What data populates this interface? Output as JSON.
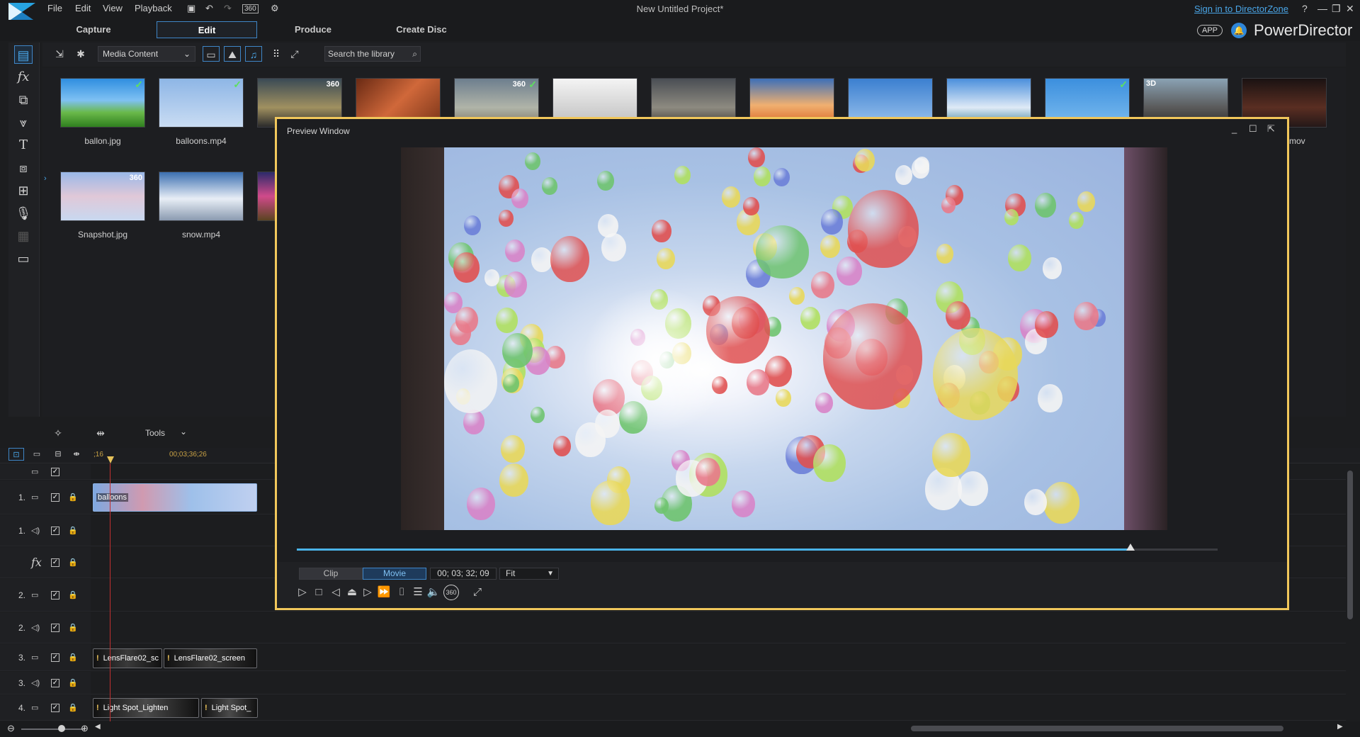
{
  "titlebar": {
    "menu": [
      "File",
      "Edit",
      "View",
      "Playback"
    ],
    "project_title": "New Untitled Project*",
    "signin": "Sign in to DirectorZone",
    "icons": [
      "save-icon",
      "undo-icon",
      "redo-icon",
      "360-icon",
      "settings-icon"
    ]
  },
  "modes": {
    "tabs": [
      "Capture",
      "Edit",
      "Produce",
      "Create Disc"
    ],
    "active": "Edit"
  },
  "brand": {
    "app_badge": "APP",
    "name": "PowerDirector"
  },
  "library_toolbar": {
    "media_dropdown": "Media Content",
    "search_placeholder": "Search the library"
  },
  "library": {
    "items": [
      {
        "label": "ballon.jpg",
        "badge": "",
        "check": true
      },
      {
        "label": "balloons.mp4",
        "badge": "",
        "check": true
      },
      {
        "label": "",
        "badge": "360",
        "check": false
      },
      {
        "label": "",
        "badge": "",
        "check": false
      },
      {
        "label": "",
        "badge": "360",
        "check": true
      },
      {
        "label": "",
        "badge": "",
        "check": false
      },
      {
        "label": "",
        "badge": "",
        "check": false
      },
      {
        "label": "",
        "badge": "",
        "check": false
      },
      {
        "label": "",
        "badge": "",
        "check": false
      },
      {
        "label": "",
        "badge": "",
        "check": false
      },
      {
        "label": "",
        "badge": "",
        "check": true
      },
      {
        "label": "",
        "badge": "3D",
        "check": false
      },
      {
        "label": "a.mov",
        "badge": "",
        "check": false
      }
    ],
    "row2": [
      {
        "label": "Snapshot.jpg",
        "badge": "360"
      },
      {
        "label": "snow.mp4",
        "badge": ""
      }
    ]
  },
  "preview": {
    "title": "Preview Window",
    "clip_label": "Clip",
    "movie_label": "Movie",
    "timecode": "00; 03; 32; 09",
    "fit_label": "Fit",
    "progress": 0.905
  },
  "timeline": {
    "tools_label": "Tools",
    "ruler_start": ";16",
    "ruler_mark": "00;03;36;26",
    "tracks": [
      {
        "num": "1.",
        "type": "video",
        "clips": [
          {
            "label": "balloons"
          }
        ]
      },
      {
        "num": "1.",
        "type": "audio",
        "clips": []
      },
      {
        "num": "",
        "type": "fx",
        "clips": []
      },
      {
        "num": "2.",
        "type": "video",
        "clips": []
      },
      {
        "num": "2.",
        "type": "audio",
        "clips": []
      },
      {
        "num": "3.",
        "type": "video",
        "clips": [
          {
            "label": "LensFlare02_sc"
          },
          {
            "label": "LensFlare02_screen"
          }
        ]
      },
      {
        "num": "3.",
        "type": "audio",
        "clips": []
      },
      {
        "num": "4.",
        "type": "video",
        "clips": [
          {
            "label": "Light Spot_Lighten"
          },
          {
            "label": "Light Spot_"
          }
        ]
      }
    ]
  },
  "colors": {
    "accent": "#3f86c7",
    "preview_border": "#f1c75b",
    "playhead": "#c03030"
  }
}
